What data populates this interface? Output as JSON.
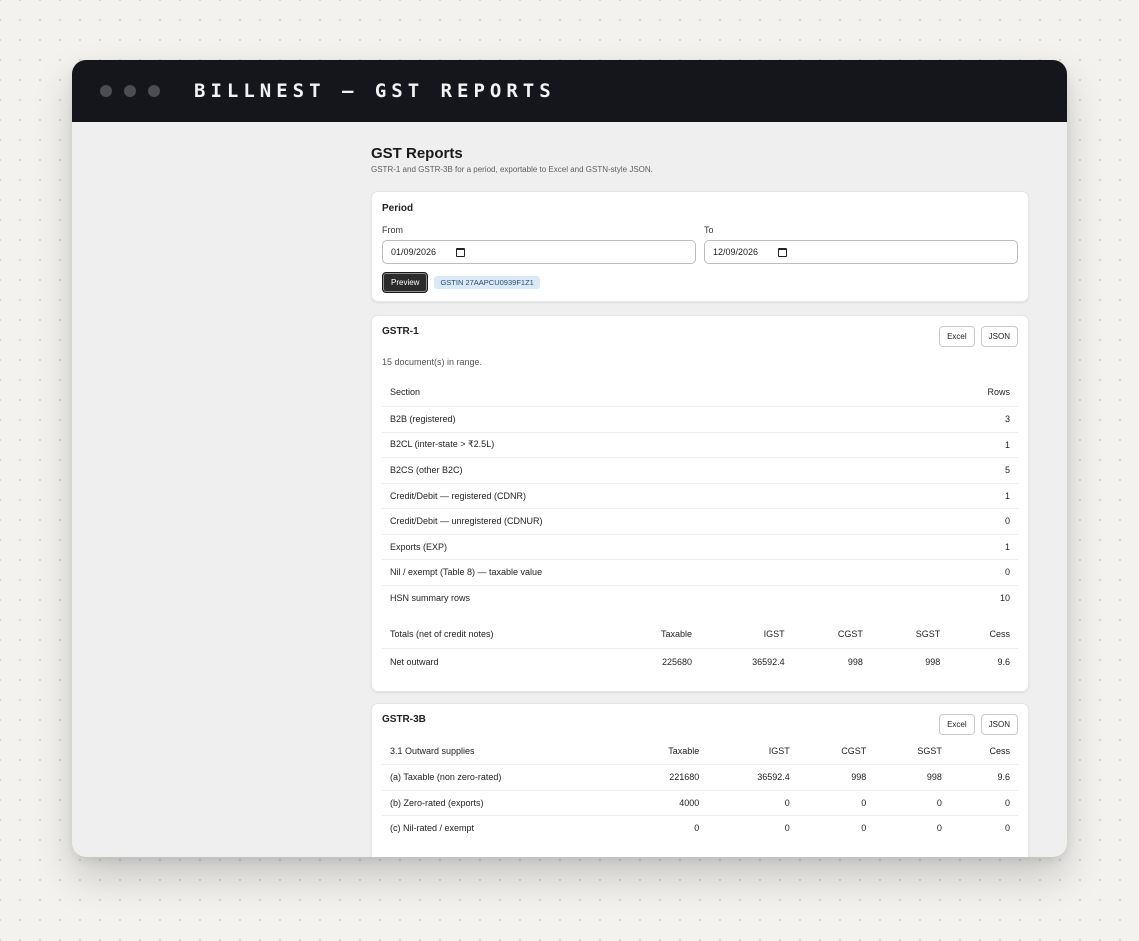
{
  "window": {
    "title": "BILLNEST — GST REPORTS"
  },
  "page": {
    "title": "GST Reports",
    "subtitle": "GSTR-1 and GSTR-3B for a period, exportable to Excel and GSTN-style JSON."
  },
  "period": {
    "title": "Period",
    "from_label": "From",
    "from_value": "01/09/2026",
    "to_label": "To",
    "to_value": "12/09/2026",
    "preview_label": "Preview",
    "gstin_badge": "GSTIN 27AAPCU0939F1Z1"
  },
  "gstr1": {
    "title": "GSTR-1",
    "excel_label": "Excel",
    "json_label": "JSON",
    "doc_count": "15 document(s) in range.",
    "section_header": "Section",
    "rows_header": "Rows",
    "sections": [
      {
        "name": "B2B (registered)",
        "rows": "3"
      },
      {
        "name": "B2CL (inter-state > ₹2.5L)",
        "rows": "1"
      },
      {
        "name": "B2CS (other B2C)",
        "rows": "5"
      },
      {
        "name": "Credit/Debit — registered (CDNR)",
        "rows": "1"
      },
      {
        "name": "Credit/Debit — unregistered (CDNUR)",
        "rows": "0"
      },
      {
        "name": "Exports (EXP)",
        "rows": "1"
      },
      {
        "name": "Nil / exempt (Table 8) — taxable value",
        "rows": "0"
      },
      {
        "name": "HSN summary rows",
        "rows": "10"
      }
    ],
    "totals_headers": [
      "Totals (net of credit notes)",
      "Taxable",
      "IGST",
      "CGST",
      "SGST",
      "Cess"
    ],
    "totals_row": [
      "Net outward",
      "225680",
      "36592.4",
      "998",
      "998",
      "9.6"
    ]
  },
  "gstr3b": {
    "title": "GSTR-3B",
    "excel_label": "Excel",
    "json_label": "JSON",
    "headers": [
      "3.1 Outward supplies",
      "Taxable",
      "IGST",
      "CGST",
      "SGST",
      "Cess"
    ],
    "rows": [
      [
        "(a) Taxable (non zero-rated)",
        "221680",
        "36592.4",
        "998",
        "998",
        "9.6"
      ],
      [
        "(b) Zero-rated (exports)",
        "4000",
        "0",
        "0",
        "0",
        "0"
      ],
      [
        "(c) Nil-rated / exempt",
        "0",
        "0",
        "0",
        "0",
        "0"
      ]
    ]
  }
}
